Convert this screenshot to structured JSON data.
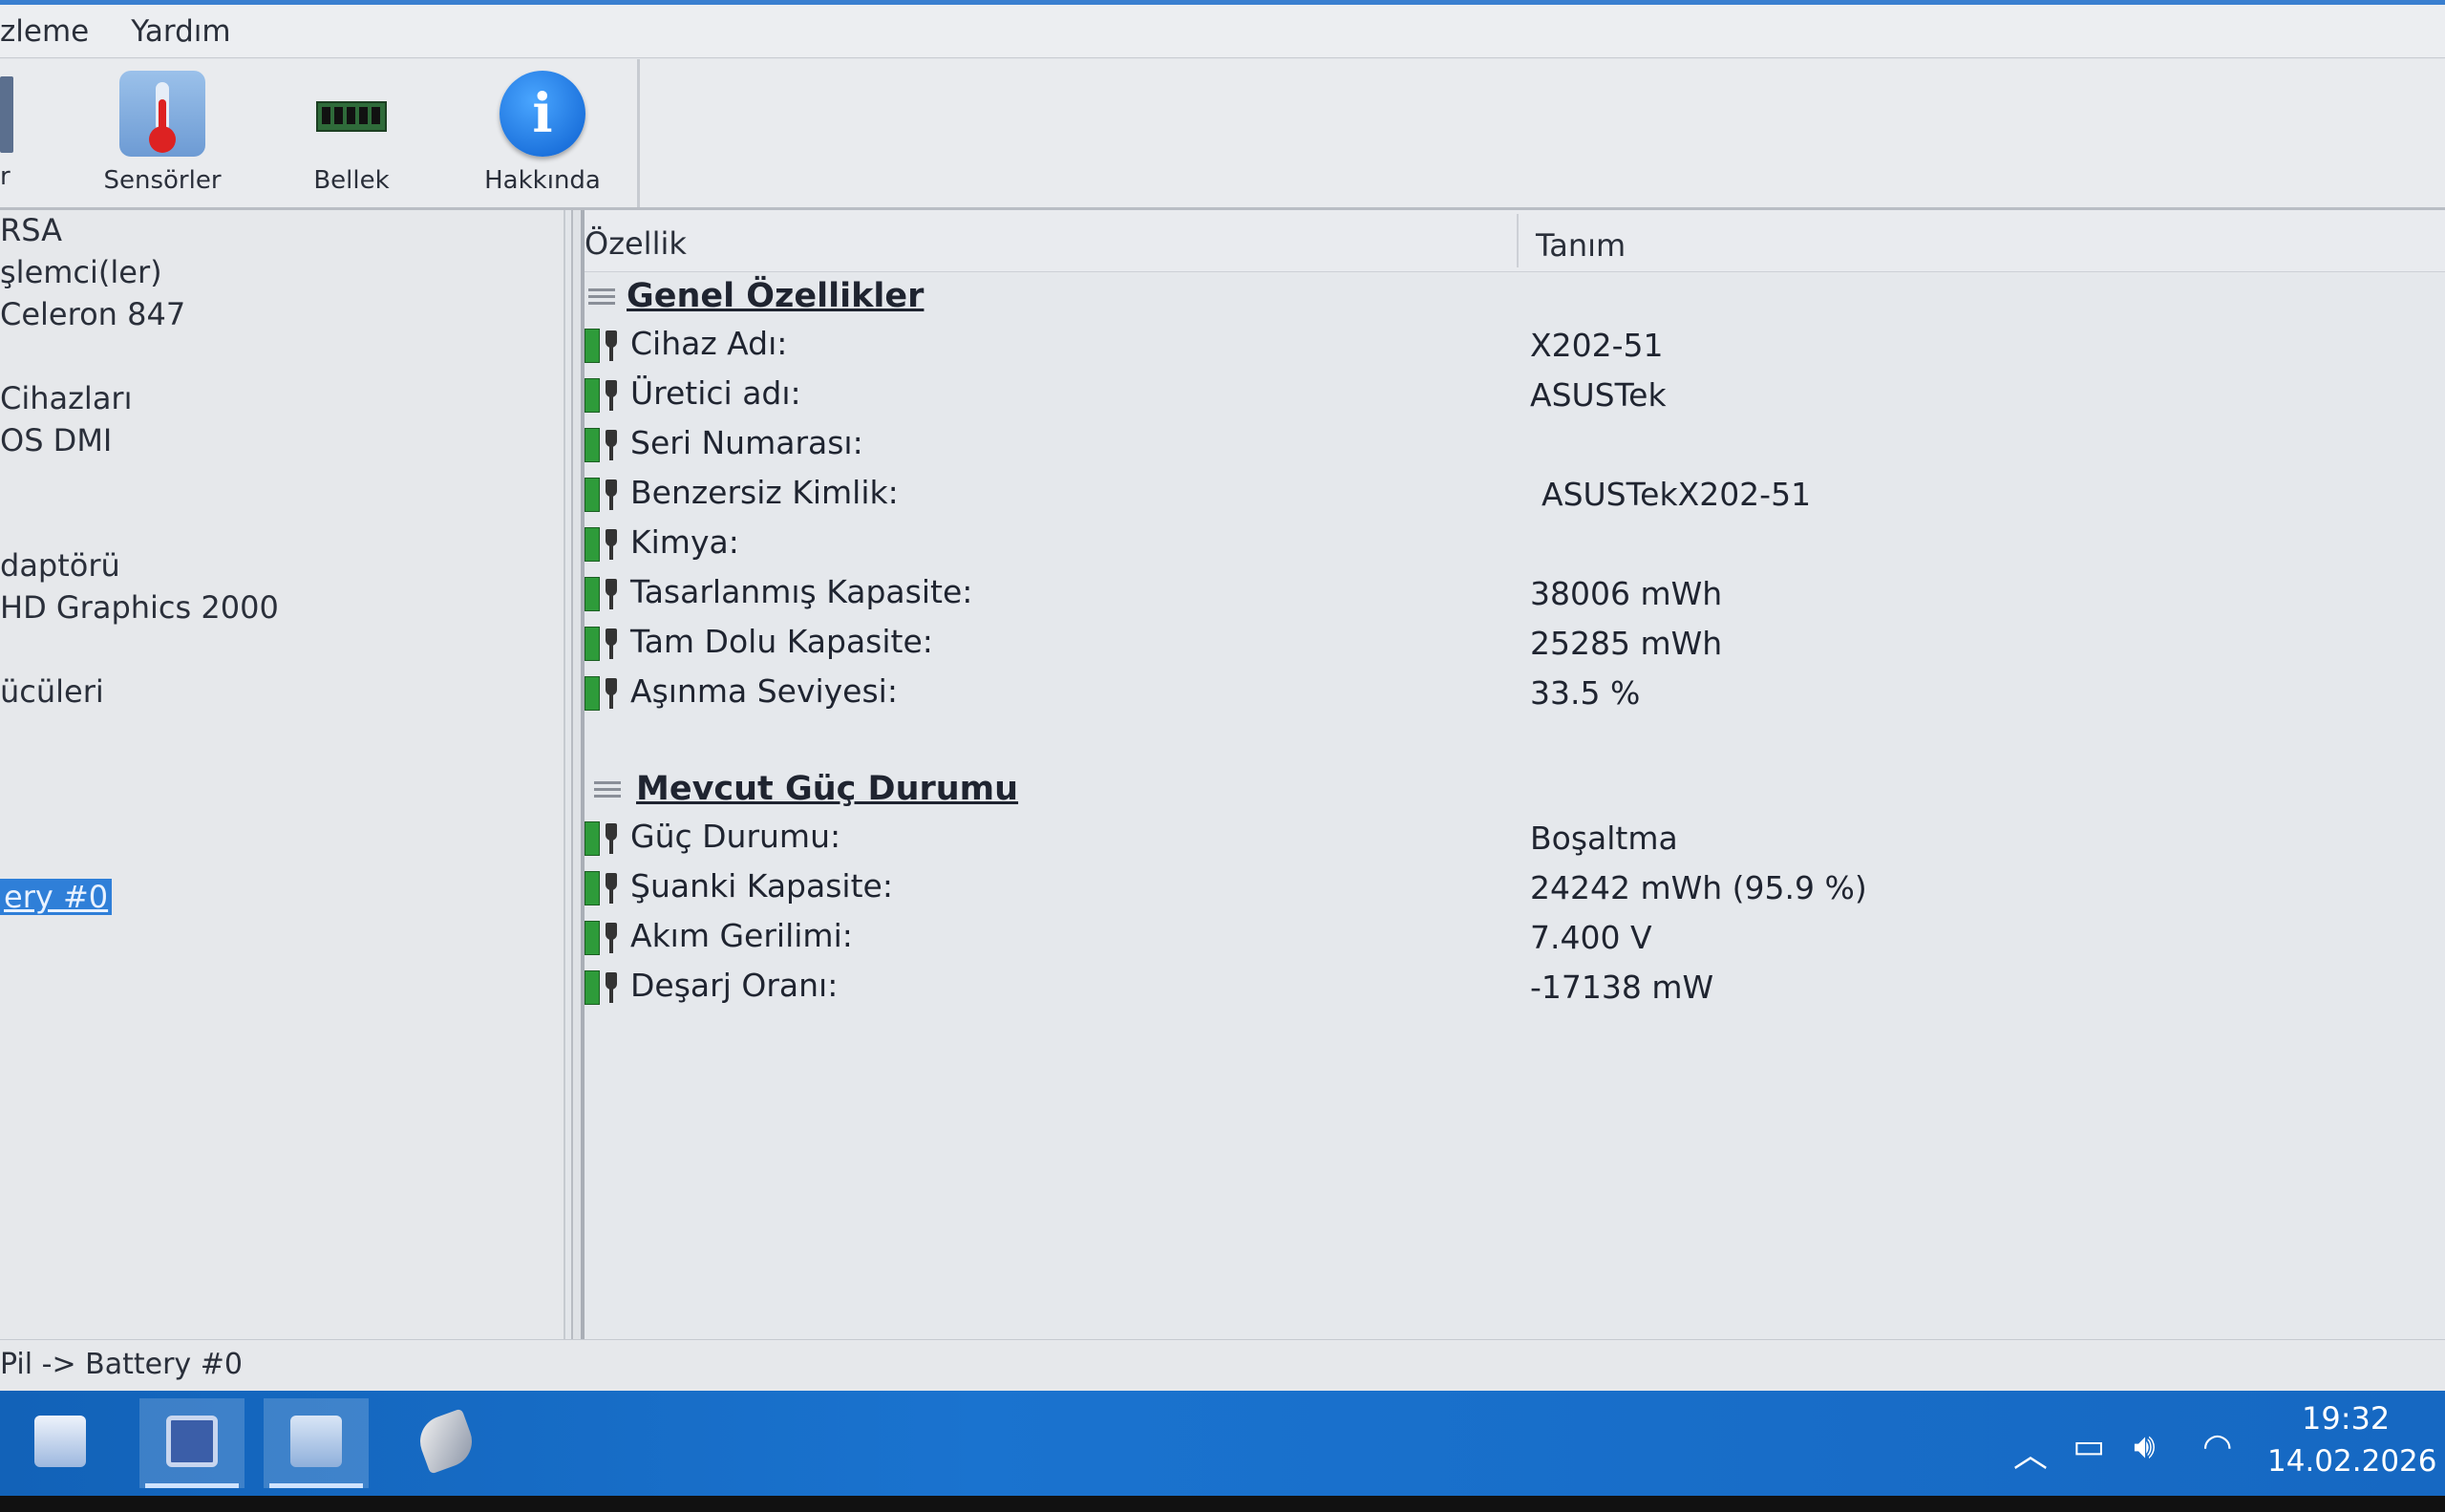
{
  "menu": {
    "items": [
      "zleme",
      "Yardım"
    ]
  },
  "toolbar": {
    "partial_label": "r",
    "buttons": [
      {
        "label": "Sensörler",
        "icon": "thermometer-icon"
      },
      {
        "label": "Bellek",
        "icon": "memory-stick-icon"
      },
      {
        "label": "Hakkında",
        "icon": "info-icon"
      }
    ]
  },
  "tree": {
    "items": [
      "RSA",
      "şlemci(ler)",
      "Celeron 847",
      "Cihazları",
      "OS DMI",
      "daptörü",
      " HD Graphics 2000",
      "ücüleri",
      "ery #0"
    ],
    "selected": "ery #0"
  },
  "columns": {
    "property": "Özellik",
    "description": "Tanım"
  },
  "sections": [
    {
      "title": "Genel Özellikler",
      "rows": [
        {
          "prop": "Cihaz Adı:",
          "val": "X202-51"
        },
        {
          "prop": "Üretici adı:",
          "val": "ASUSTek"
        },
        {
          "prop": "Seri Numarası:",
          "val": ""
        },
        {
          "prop": "Benzersiz Kimlik:",
          "val": "ASUSTekX202-51"
        },
        {
          "prop": "Kimya:",
          "val": ""
        },
        {
          "prop": "Tasarlanmış Kapasite:",
          "val": "38006 mWh"
        },
        {
          "prop": "Tam Dolu Kapasite:",
          "val": "25285 mWh"
        },
        {
          "prop": "Aşınma Seviyesi:",
          "val": "33.5 %"
        }
      ]
    },
    {
      "title": "Mevcut Güç Durumu",
      "rows": [
        {
          "prop": "Güç Durumu:",
          "val": "Boşaltma"
        },
        {
          "prop": "Şuanki Kapasite:",
          "val": "24242 mWh (95.9 %)"
        },
        {
          "prop": "Akım Gerilimi:",
          "val": "7.400 V"
        },
        {
          "prop": "Deşarj Oranı:",
          "val": "-17138 mW"
        }
      ]
    }
  ],
  "status": {
    "path": "Pil -> Battery #0"
  },
  "taskbar": {
    "time": "19:32",
    "date": "14.02.2026"
  },
  "colors": {
    "accent": "#2f7fd8",
    "taskbar": "#1a73cf",
    "status_green": "#2e9b3a"
  }
}
